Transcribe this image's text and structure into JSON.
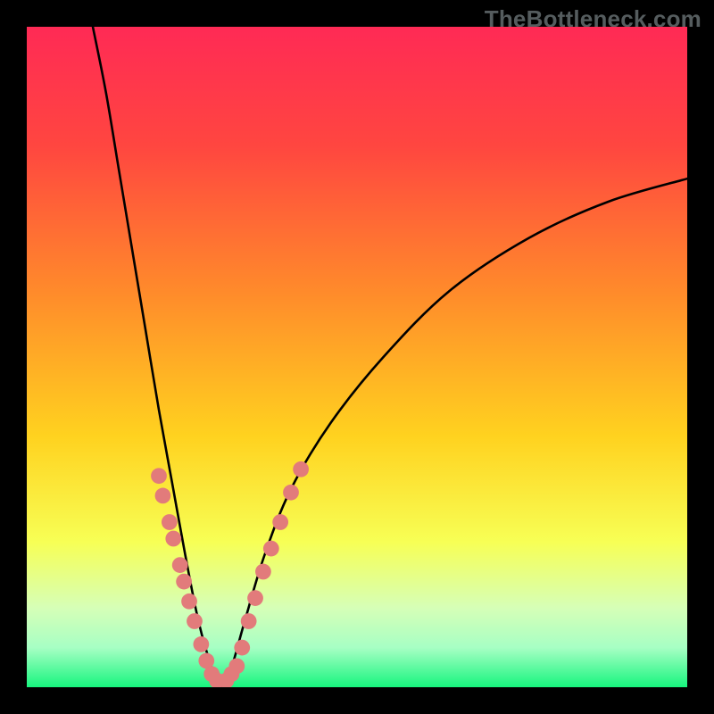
{
  "watermark": "TheBottleneck.com",
  "chart_data": {
    "type": "line",
    "title": "",
    "xlabel": "",
    "ylabel": "",
    "xlim": [
      0,
      100
    ],
    "ylim": [
      0,
      100
    ],
    "background_gradient_stops": [
      {
        "offset": 0.0,
        "color": "#ff2a55"
      },
      {
        "offset": 0.18,
        "color": "#ff4640"
      },
      {
        "offset": 0.4,
        "color": "#ff8a2b"
      },
      {
        "offset": 0.62,
        "color": "#ffd21f"
      },
      {
        "offset": 0.78,
        "color": "#f7ff55"
      },
      {
        "offset": 0.88,
        "color": "#d6ffb7"
      },
      {
        "offset": 0.94,
        "color": "#a7ffc4"
      },
      {
        "offset": 1.0,
        "color": "#17f57e"
      }
    ],
    "curve": {
      "vertex_x": 29.5,
      "points": [
        {
          "x": 10.0,
          "y": 100.0
        },
        {
          "x": 12.0,
          "y": 90.0
        },
        {
          "x": 14.0,
          "y": 78.0
        },
        {
          "x": 16.0,
          "y": 66.0
        },
        {
          "x": 18.0,
          "y": 54.0
        },
        {
          "x": 20.0,
          "y": 42.0
        },
        {
          "x": 22.0,
          "y": 31.0
        },
        {
          "x": 24.0,
          "y": 20.0
        },
        {
          "x": 26.0,
          "y": 10.0
        },
        {
          "x": 28.0,
          "y": 3.0
        },
        {
          "x": 29.5,
          "y": 0.0
        },
        {
          "x": 31.0,
          "y": 3.0
        },
        {
          "x": 33.0,
          "y": 10.0
        },
        {
          "x": 36.0,
          "y": 20.0
        },
        {
          "x": 40.0,
          "y": 30.0
        },
        {
          "x": 46.0,
          "y": 40.0
        },
        {
          "x": 54.0,
          "y": 50.0
        },
        {
          "x": 64.0,
          "y": 60.0
        },
        {
          "x": 76.0,
          "y": 68.0
        },
        {
          "x": 88.0,
          "y": 73.5
        },
        {
          "x": 100.0,
          "y": 77.0
        }
      ]
    },
    "markers": {
      "color": "#e27b7b",
      "radius": 1.2,
      "points": [
        {
          "x": 20.0,
          "y": 32.0
        },
        {
          "x": 20.6,
          "y": 29.0
        },
        {
          "x": 21.6,
          "y": 25.0
        },
        {
          "x": 22.2,
          "y": 22.5
        },
        {
          "x": 23.2,
          "y": 18.5
        },
        {
          "x": 23.8,
          "y": 16.0
        },
        {
          "x": 24.6,
          "y": 13.0
        },
        {
          "x": 25.4,
          "y": 10.0
        },
        {
          "x": 26.4,
          "y": 6.5
        },
        {
          "x": 27.2,
          "y": 4.0
        },
        {
          "x": 28.0,
          "y": 2.0
        },
        {
          "x": 28.8,
          "y": 1.0
        },
        {
          "x": 30.2,
          "y": 1.0
        },
        {
          "x": 31.0,
          "y": 2.0
        },
        {
          "x": 31.8,
          "y": 3.2
        },
        {
          "x": 32.6,
          "y": 6.0
        },
        {
          "x": 33.6,
          "y": 10.0
        },
        {
          "x": 34.6,
          "y": 13.5
        },
        {
          "x": 35.8,
          "y": 17.5
        },
        {
          "x": 37.0,
          "y": 21.0
        },
        {
          "x": 38.4,
          "y": 25.0
        },
        {
          "x": 40.0,
          "y": 29.5
        },
        {
          "x": 41.5,
          "y": 33.0
        }
      ]
    }
  }
}
